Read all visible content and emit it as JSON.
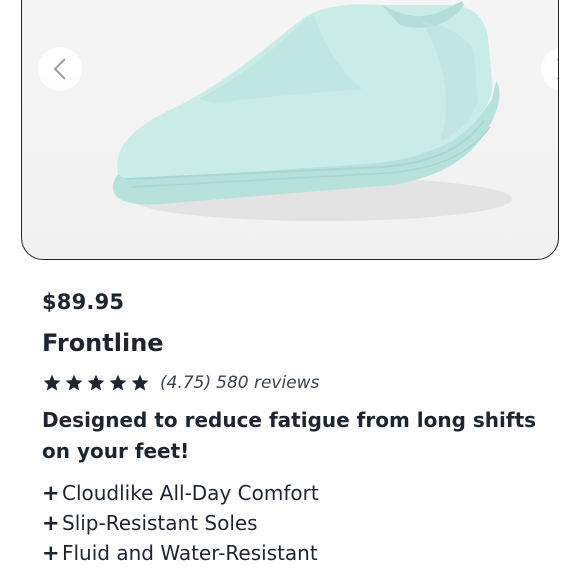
{
  "product": {
    "price": "$89.95",
    "name": "Frontline",
    "rating_value": "(4.75)",
    "review_count": "580 reviews",
    "stars_filled": 5,
    "stars_total": 5,
    "headline": "Designed to reduce fatigue from long shifts on your feet!",
    "features": [
      {
        "marker": "+",
        "text": "Cloudlike All-Day Comfort"
      },
      {
        "marker": "+",
        "text": "Slip-Resistant Soles"
      },
      {
        "marker": "+",
        "text": "Fluid and Water-Resistant"
      }
    ]
  },
  "gallery": {
    "prev_icon": "chevron-left-icon",
    "next_icon": "chevron-right-icon",
    "image_subject": "mint slip-on shoe"
  },
  "colors": {
    "text": "#1d2630",
    "shoe": "#c9ece7",
    "card_border": "#22272e",
    "star": "#1d2630"
  }
}
